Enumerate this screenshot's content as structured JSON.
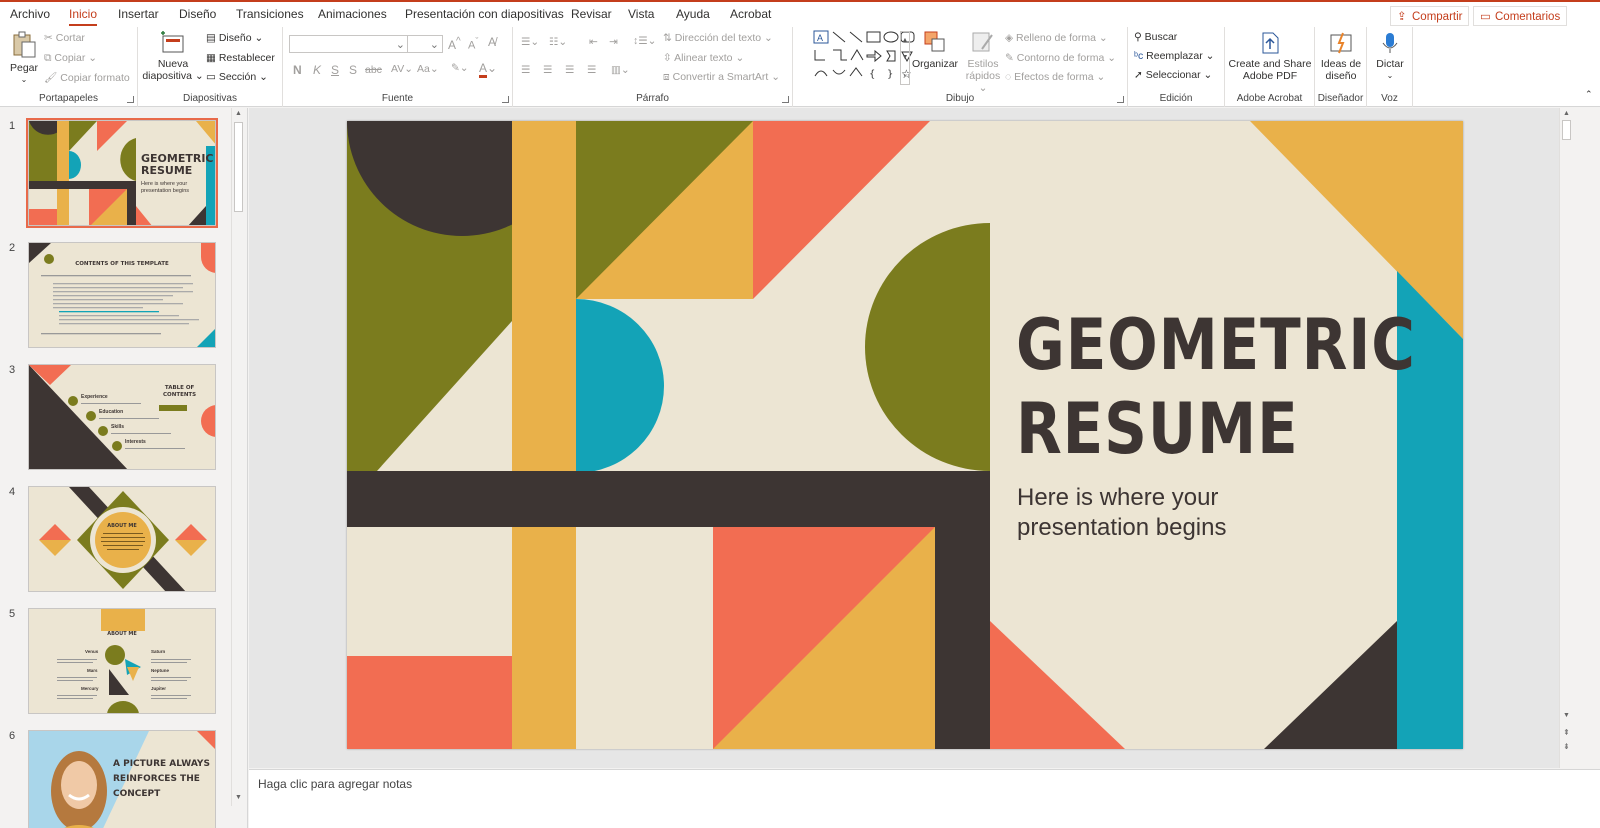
{
  "menu": {
    "tabs": [
      "Archivo",
      "Inicio",
      "Insertar",
      "Diseño",
      "Transiciones",
      "Animaciones",
      "Presentación con diapositivas",
      "Revisar",
      "Vista",
      "Ayuda",
      "Acrobat"
    ],
    "active_tab": "Inicio",
    "share_label": "Compartir",
    "comments_label": "Comentarios"
  },
  "ribbon": {
    "clipboard": {
      "paste": "Pegar",
      "cut": "Cortar",
      "copy": "Copiar",
      "format_painter": "Copiar formato",
      "label": "Portapapeles"
    },
    "slides": {
      "new_slide_line1": "Nueva",
      "new_slide_line2": "diapositiva",
      "layout": "Diseño",
      "reset": "Restablecer",
      "section": "Sección",
      "label": "Diapositivas"
    },
    "font": {
      "bold": "N",
      "italic": "K",
      "underline": "S",
      "shadow": "S",
      "strike": "abc",
      "label": "Fuente"
    },
    "paragraph": {
      "text_direction": "Dirección del texto",
      "align_text": "Alinear texto",
      "smartart": "Convertir a SmartArt",
      "label": "Párrafo"
    },
    "drawing": {
      "arrange": "Organizar",
      "quick_styles_line1": "Estilos",
      "quick_styles_line2": "rápidos",
      "shape_fill": "Relleno de forma",
      "shape_outline": "Contorno de forma",
      "shape_effects": "Efectos de forma",
      "label": "Dibujo"
    },
    "editing": {
      "find": "Buscar",
      "replace": "Reemplazar",
      "select": "Seleccionar",
      "label": "Edición"
    },
    "acrobat": {
      "create_line1": "Create and Share",
      "create_line2": "Adobe PDF",
      "label": "Adobe Acrobat"
    },
    "designer": {
      "ideas_line1": "Ideas de",
      "ideas_line2": "diseño",
      "label": "Diseñador"
    },
    "voice": {
      "dictate": "Dictar",
      "label": "Voz"
    }
  },
  "thumbnails": [
    {
      "num": "1",
      "title_line1": "GEOMETRIC",
      "title_line2": "RESUME",
      "sub_line1": "Here is where your",
      "sub_line2": "presentation begins"
    },
    {
      "num": "2",
      "title": "CONTENTS OF THIS TEMPLATE"
    },
    {
      "num": "3",
      "title_line1": "TABLE OF",
      "title_line2": "CONTENTS",
      "items": [
        "Experience",
        "Education",
        "Skills",
        "Interests"
      ]
    },
    {
      "num": "4",
      "title": "ABOUT ME"
    },
    {
      "num": "5",
      "title": "ABOUT ME",
      "items": [
        "Venus",
        "Saturn",
        "Mars",
        "Neptune",
        "Mercury",
        "Jupiter"
      ]
    },
    {
      "num": "6",
      "title_line1": "A PICTURE ALWAYS",
      "title_line2": "REINFORCES THE",
      "title_line3": "CONCEPT"
    }
  ],
  "slide": {
    "title_line1": "GEOMETRIC",
    "title_line2": "RESUME",
    "subtitle_line1": "Here is where your",
    "subtitle_line2": "presentation begins",
    "colors": {
      "cream": "#ece5d3",
      "olive": "#7b7c1e",
      "dark": "#3d3533",
      "mustard": "#e9b14a",
      "coral": "#f26d52",
      "teal": "#13a3b7"
    }
  },
  "notes": {
    "placeholder": "Haga clic para agregar notas"
  }
}
